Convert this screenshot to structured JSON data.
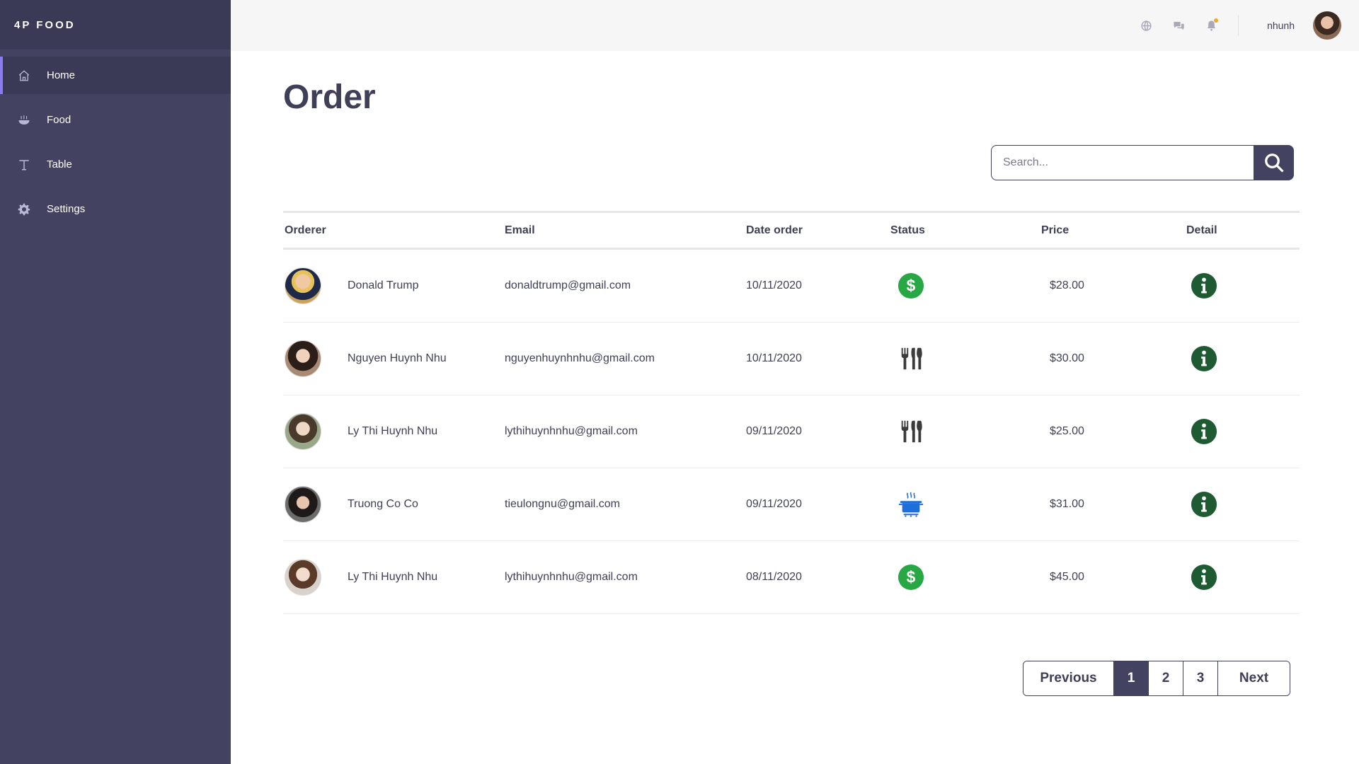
{
  "brand": "4P FOOD",
  "sidebar": {
    "items": [
      {
        "label": "Home",
        "icon": "home-icon",
        "active": true
      },
      {
        "label": "Food",
        "icon": "bowl-icon"
      },
      {
        "label": "Table",
        "icon": "table-icon"
      },
      {
        "label": "Settings",
        "icon": "gear-icon"
      }
    ]
  },
  "topbar": {
    "icons": [
      "globe-icon",
      "chat-icon",
      "bell-icon"
    ],
    "username": "nhunh"
  },
  "page": {
    "title": "Order"
  },
  "search": {
    "placeholder": "Search..."
  },
  "table": {
    "headers": {
      "orderer": "Orderer",
      "email": "Email",
      "date": "Date order",
      "status": "Status",
      "price": "Price",
      "detail": "Detail"
    },
    "rows": [
      {
        "name": "Donald Trump",
        "email": "donaldtrump@gmail.com",
        "date": "10/11/2020",
        "status": "paid",
        "price": "$28.00"
      },
      {
        "name": "Nguyen Huynh Nhu",
        "email": "nguyenhuynhnhu@gmail.com",
        "date": "10/11/2020",
        "status": "served",
        "price": "$30.00"
      },
      {
        "name": "Ly Thi Huynh Nhu",
        "email": "lythihuynhnhu@gmail.com",
        "date": "09/11/2020",
        "status": "served",
        "price": "$25.00"
      },
      {
        "name": "Truong Co Co",
        "email": "tieulongnu@gmail.com",
        "date": "09/11/2020",
        "status": "cooking",
        "price": "$31.00"
      },
      {
        "name": "Ly Thi Huynh Nhu",
        "email": "lythihuynhnhu@gmail.com",
        "date": "08/11/2020",
        "status": "paid",
        "price": "$45.00"
      }
    ]
  },
  "pagination": {
    "previous": "Previous",
    "pages": [
      "1",
      "2",
      "3"
    ],
    "current": "1",
    "next": "Next"
  },
  "colors": {
    "sidebar": "#434261",
    "accent": "#8a7cf0",
    "paid": "#28a745",
    "detail": "#1e5b33",
    "cooking": "#1e6fd9"
  }
}
